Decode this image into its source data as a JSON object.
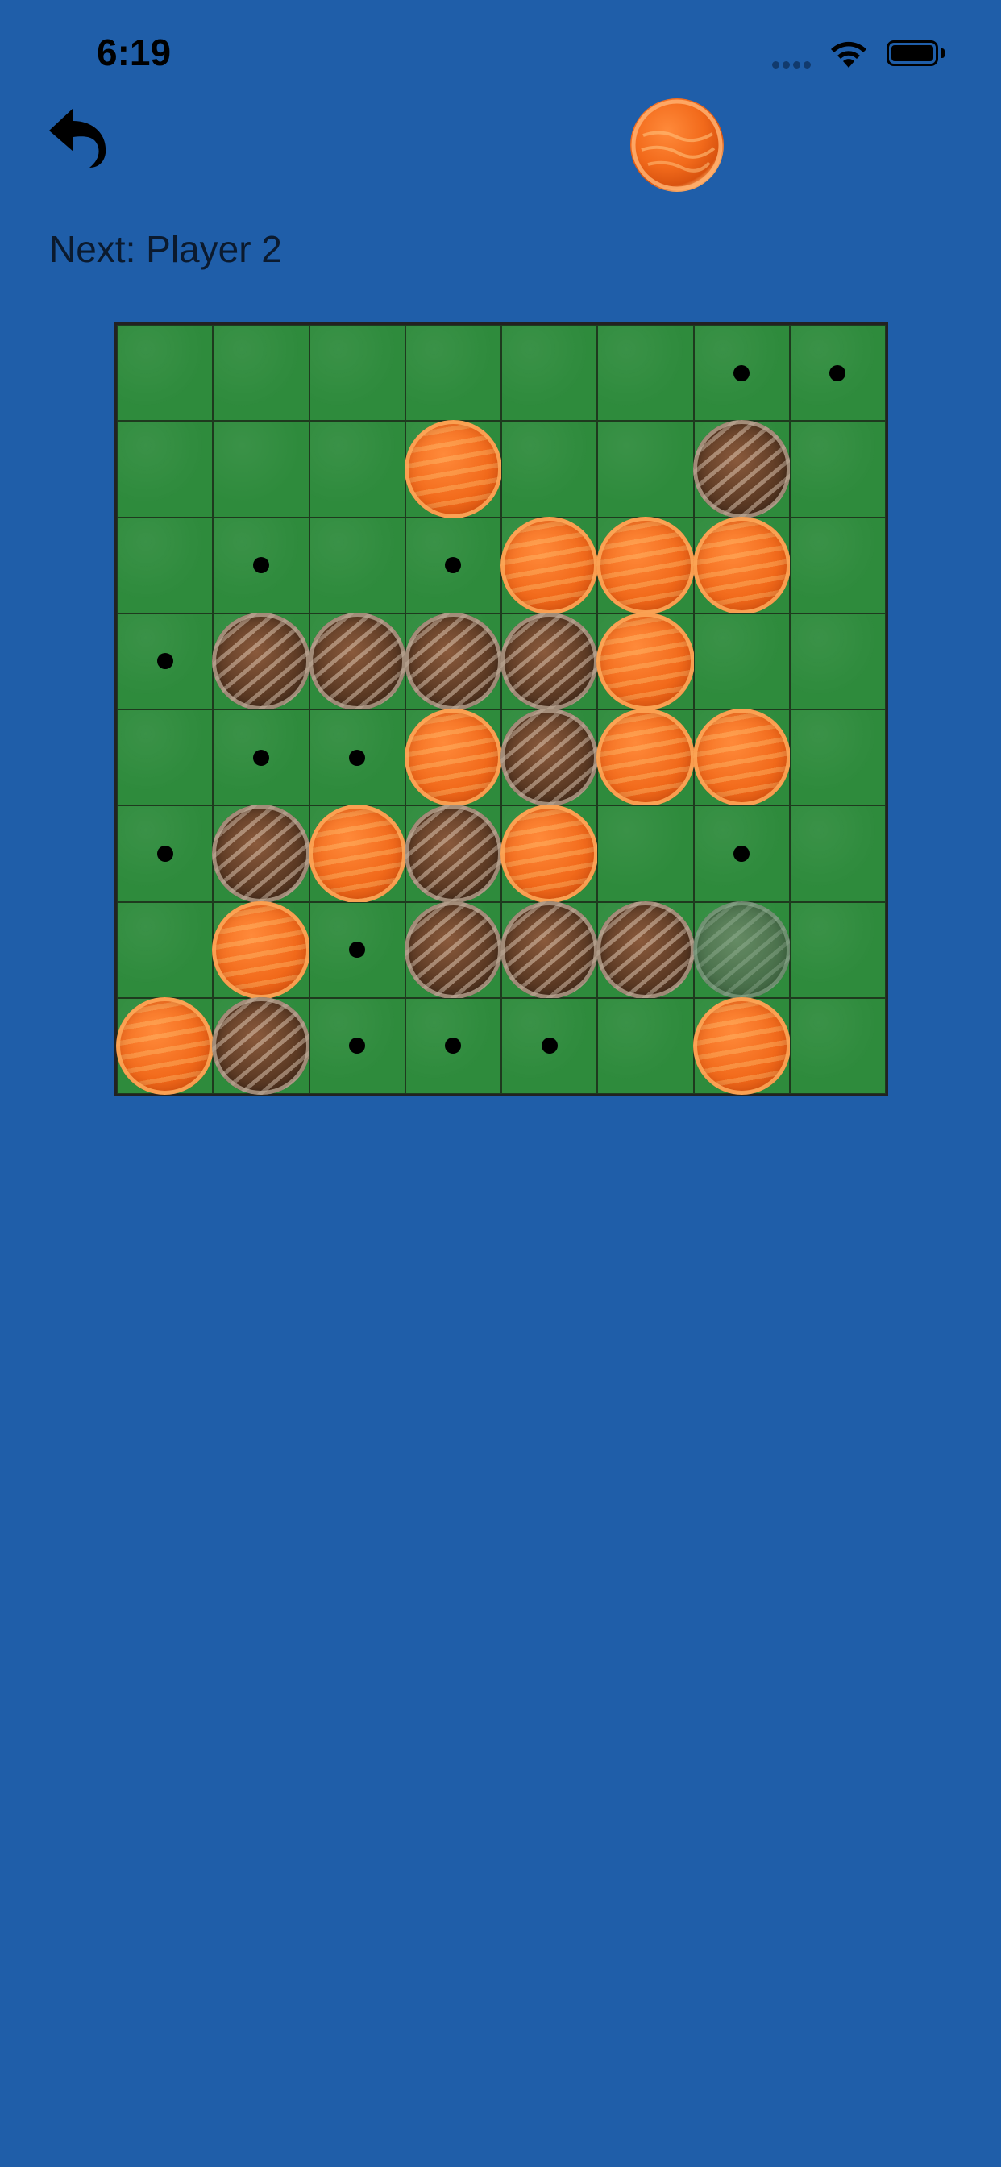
{
  "status_bar": {
    "time": "6:19",
    "signal_icon": "cellular-signal-icon",
    "wifi_icon": "wifi-icon",
    "battery_icon": "battery-icon"
  },
  "toolbar": {
    "undo_icon": "undo-arrow-icon",
    "current_piece_icon": "orange-disc-icon"
  },
  "status": {
    "next_text": "Next: Player 2"
  },
  "colors": {
    "background": "#1f5ea9",
    "board_green": "#2e8b3c",
    "player1_piece": "#f26a1b",
    "player2_piece": "#5c3a24"
  },
  "board": {
    "size": 8,
    "legend": {
      "O": "orange piece",
      "B": "brown piece",
      "G": "ghost preview piece",
      ".": "valid move marker",
      "-": "empty"
    },
    "rows": [
      "------..",
      "---O--B-",
      "-.-.OOO-",
      ".BBBBO--",
      "-..OBOO-",
      ".BOBO-.-",
      "-O.BBBG-",
      "OB...-O-"
    ]
  }
}
